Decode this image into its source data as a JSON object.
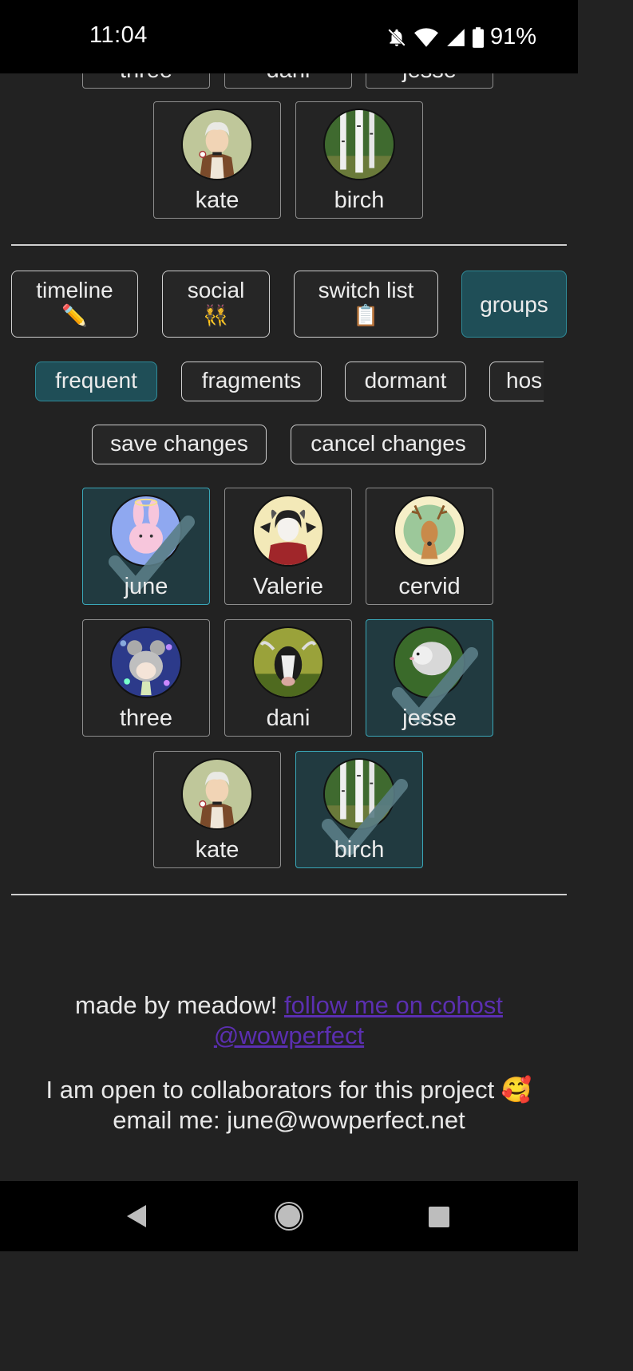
{
  "status": {
    "time": "11:04",
    "battery": "91%"
  },
  "top_partial_members": [
    "three",
    "dani",
    "jesse"
  ],
  "top_members": [
    {
      "name": "kate",
      "avatar": "kate-avatar"
    },
    {
      "name": "birch",
      "avatar": "birch-avatar"
    }
  ],
  "tabs": [
    {
      "label": "timeline",
      "emoji": "✏️"
    },
    {
      "label": "social",
      "emoji": "👯"
    },
    {
      "label": "switch list",
      "emoji": "📋"
    },
    {
      "label": "groups",
      "emoji": ""
    }
  ],
  "active_tab": "groups",
  "groups": [
    "frequent",
    "fragments",
    "dormant",
    "hos"
  ],
  "active_group": "frequent",
  "actions": {
    "save": "save changes",
    "cancel": "cancel changes"
  },
  "members": [
    {
      "name": "june",
      "selected": true
    },
    {
      "name": "Valerie",
      "selected": false
    },
    {
      "name": "cervid",
      "selected": false
    },
    {
      "name": "three",
      "selected": false
    },
    {
      "name": "dani",
      "selected": false
    },
    {
      "name": "jesse",
      "selected": true
    },
    {
      "name": "kate",
      "selected": false
    },
    {
      "name": "birch",
      "selected": true
    }
  ],
  "footer": {
    "made_by": "made by meadow!",
    "link_text": "follow me on cohost",
    "link_handle": "@wowperfect",
    "collab": "I am open to collaborators for this project 🥰",
    "email": "email me: june@wowperfect.net"
  },
  "colors": {
    "background": "#222222",
    "selected_accent": "#3aa7b8",
    "active_tab_bg": "#1f4e57",
    "link": "#5b2fb0"
  },
  "icons": {
    "silent": "bell-off-icon",
    "wifi": "wifi-icon",
    "signal": "cell-signal-icon",
    "battery": "battery-icon",
    "back": "back-triangle-icon",
    "home": "home-circle-icon",
    "recents": "recents-square-icon",
    "check": "checkmark-icon"
  }
}
